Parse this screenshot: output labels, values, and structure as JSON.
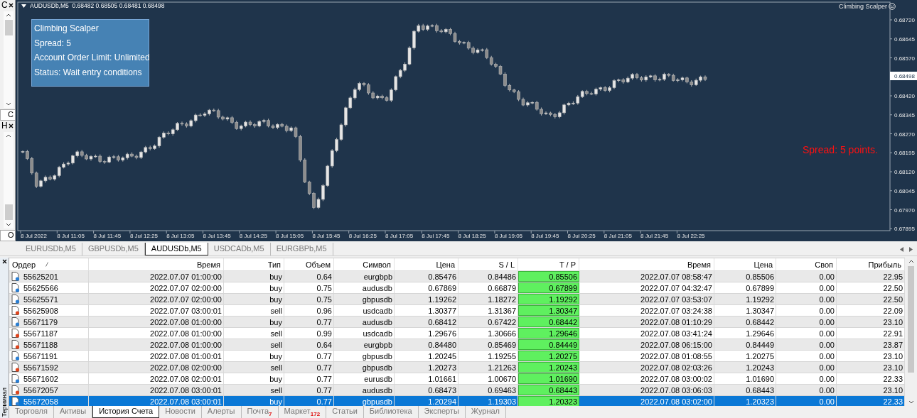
{
  "side_panels": [
    {
      "title": "C",
      "tab": "C"
    },
    {
      "title": "H",
      "tab": "O"
    }
  ],
  "chart": {
    "symbol_line": "AUDUSDb,M5  0.68482 0.68505 0.68481 0.68498",
    "expert_name": "Climbing Scalper",
    "info_panel": [
      "Climbing Scalper",
      "Spread: 5",
      "Account Order Limit: Unlimited",
      "Status: Wait entry conditions"
    ],
    "spread_label": "Spread: 5 points.",
    "current_price": "0.68498",
    "price_axis": [
      "0.68720",
      "0.68645",
      "0.68570",
      "0.68420",
      "0.68345",
      "0.68270",
      "0.68195",
      "0.68120",
      "0.68045",
      "0.67970",
      "0.67895"
    ],
    "time_axis": [
      "8 Jul 2022",
      "8 Jul 11:05",
      "8 Jul 11:45",
      "8 Jul 12:25",
      "8 Jul 13:05",
      "8 Jul 13:45",
      "8 Jul 14:25",
      "8 Jul 15:05",
      "8 Jul 15:45",
      "8 Jul 16:25",
      "8 Jul 17:05",
      "8 Jul 17:45",
      "8 Jul 18:25",
      "8 Jul 19:05",
      "8 Jul 19:45",
      "8 Jul 20:25",
      "8 Jul 21:05",
      "8 Jul 21:45",
      "8 Jul 22:25"
    ]
  },
  "chart_tabs": [
    {
      "label": "EURUSDb,M5",
      "selected": false
    },
    {
      "label": "GBPUSDb,M5",
      "selected": false
    },
    {
      "label": "AUDUSDb,M5",
      "selected": true
    },
    {
      "label": "USDCADb,M5",
      "selected": false
    },
    {
      "label": "EURGBPb,M5",
      "selected": false
    }
  ],
  "terminal": {
    "side_label": "Терминал",
    "columns": [
      "Ордер",
      "Время",
      "Тип",
      "Объем",
      "Символ",
      "Цена",
      "S / L",
      "T / P",
      "Время",
      "Цена",
      "Своп",
      "Прибыль"
    ],
    "rows": [
      {
        "kind": "buy",
        "selected": false,
        "cells": [
          "55625201",
          "2022.07.07 01:00:00",
          "buy",
          "0.64",
          "eurgbpb",
          "0.85476",
          "0.84486",
          "0.85506",
          "2022.07.07 08:58:47",
          "0.85506",
          "0.00",
          "22.95"
        ]
      },
      {
        "kind": "buy",
        "selected": false,
        "cells": [
          "55625566",
          "2022.07.07 02:00:00",
          "buy",
          "0.75",
          "audusdb",
          "0.67869",
          "0.66879",
          "0.67899",
          "2022.07.07 04:32:47",
          "0.67899",
          "0.00",
          "22.50"
        ]
      },
      {
        "kind": "buy",
        "selected": false,
        "cells": [
          "55625571",
          "2022.07.07 02:00:00",
          "buy",
          "0.75",
          "gbpusdb",
          "1.19262",
          "1.18272",
          "1.19292",
          "2022.07.07 03:53:07",
          "1.19292",
          "0.00",
          "22.50"
        ]
      },
      {
        "kind": "sell",
        "selected": false,
        "cells": [
          "55625908",
          "2022.07.07 03:00:01",
          "sell",
          "0.96",
          "usdcadb",
          "1.30377",
          "1.31367",
          "1.30347",
          "2022.07.07 03:24:38",
          "1.30347",
          "0.00",
          "22.09"
        ]
      },
      {
        "kind": "buy",
        "selected": false,
        "cells": [
          "55671179",
          "2022.07.08 01:00:00",
          "buy",
          "0.77",
          "audusdb",
          "0.68412",
          "0.67422",
          "0.68442",
          "2022.07.08 01:10:29",
          "0.68442",
          "0.00",
          "23.10"
        ]
      },
      {
        "kind": "sell",
        "selected": false,
        "cells": [
          "55671187",
          "2022.07.08 01:00:00",
          "sell",
          "0.99",
          "usdcadb",
          "1.29676",
          "1.30666",
          "1.29646",
          "2022.07.08 03:41:24",
          "1.29646",
          "0.00",
          "22.91"
        ]
      },
      {
        "kind": "sell",
        "selected": false,
        "cells": [
          "55671188",
          "2022.07.08 01:00:00",
          "sell",
          "0.64",
          "eurgbpb",
          "0.84480",
          "0.85469",
          "0.84449",
          "2022.07.08 06:15:00",
          "0.84449",
          "0.00",
          "23.87"
        ]
      },
      {
        "kind": "buy",
        "selected": false,
        "cells": [
          "55671191",
          "2022.07.08 01:00:01",
          "buy",
          "0.77",
          "gbpusdb",
          "1.20245",
          "1.19255",
          "1.20275",
          "2022.07.08 01:08:55",
          "1.20275",
          "0.00",
          "23.10"
        ]
      },
      {
        "kind": "sell",
        "selected": false,
        "cells": [
          "55671592",
          "2022.07.08 02:00:00",
          "sell",
          "0.77",
          "gbpusdb",
          "1.20273",
          "1.21263",
          "1.20243",
          "2022.07.08 02:03:26",
          "1.20243",
          "0.00",
          "23.10"
        ]
      },
      {
        "kind": "buy",
        "selected": false,
        "cells": [
          "55671602",
          "2022.07.08 02:00:01",
          "buy",
          "0.77",
          "eurusdb",
          "1.01661",
          "1.00670",
          "1.01690",
          "2022.07.08 03:00:02",
          "1.01690",
          "0.00",
          "22.33"
        ]
      },
      {
        "kind": "sell",
        "selected": false,
        "cells": [
          "55672057",
          "2022.07.08 03:00:01",
          "sell",
          "0.77",
          "audusdb",
          "0.68473",
          "0.69463",
          "0.68443",
          "2022.07.08 03:06:03",
          "0.68443",
          "0.00",
          "23.10"
        ]
      },
      {
        "kind": "buy",
        "selected": true,
        "cells": [
          "55672058",
          "2022.07.08 03:00:01",
          "buy",
          "0.77",
          "gbpusdb",
          "1.20294",
          "1.19303",
          "1.20323",
          "2022.07.08 03:02:00",
          "1.20323",
          "0.00",
          "22.33"
        ]
      }
    ],
    "tabs": [
      {
        "label": "Торговля",
        "selected": false
      },
      {
        "label": "Активы",
        "selected": false
      },
      {
        "label": "История Счета",
        "selected": true
      },
      {
        "label": "Новости",
        "selected": false
      },
      {
        "label": "Алерты",
        "selected": false
      },
      {
        "label": "Почта",
        "badge": "7",
        "selected": false
      },
      {
        "label": "Маркет",
        "badge": "172",
        "selected": false
      },
      {
        "label": "Статьи",
        "selected": false
      },
      {
        "label": "Библиотека",
        "selected": false
      },
      {
        "label": "Эксперты",
        "selected": false
      },
      {
        "label": "Журнал",
        "selected": false
      }
    ]
  }
}
